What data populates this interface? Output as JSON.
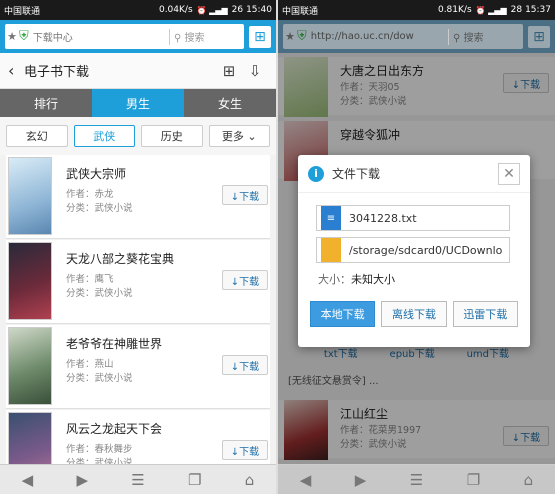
{
  "left": {
    "status": {
      "carrier": "中国联通",
      "speed": "0.04K/s",
      "battery": "26",
      "time": "15:40"
    },
    "urlbar": {
      "url": "下载中心",
      "search_placeholder": "搜索"
    },
    "header": {
      "title": "电子书下载"
    },
    "tabs": [
      {
        "label": "排行"
      },
      {
        "label": "男生"
      },
      {
        "label": "女生"
      }
    ],
    "categories": [
      {
        "label": "玄幻"
      },
      {
        "label": "武侠"
      },
      {
        "label": "历史"
      },
      {
        "label": "更多 ⌄"
      }
    ],
    "books": [
      {
        "title": "武侠大宗师",
        "author": "作者：赤龙",
        "category": "分类：武侠小说",
        "button": "↓下载"
      },
      {
        "title": "天龙八部之葵花宝典",
        "author": "作者：鹰飞",
        "category": "分类：武侠小说",
        "button": "↓下载"
      },
      {
        "title": "老爷爷在神雕世界",
        "author": "作者：燕山",
        "category": "分类：武侠小说",
        "button": "↓下载"
      },
      {
        "title": "风云之龙起天下会",
        "author": "作者：春秋舞步",
        "category": "分类：武侠小说",
        "button": "↓下载"
      }
    ],
    "colors": {
      "accent": "#1e9fd9"
    }
  },
  "right": {
    "status": {
      "carrier": "中国联通",
      "speed": "0.81K/s",
      "battery": "28",
      "time": "15:37"
    },
    "urlbar": {
      "url": "http://hao.uc.cn/dow",
      "search_placeholder": "搜索"
    },
    "books": [
      {
        "title": "大唐之日出东方",
        "author": "作者：天羽05",
        "category": "分类：武侠小说",
        "button": "↓下载"
      },
      {
        "title": "穿越令狐冲",
        "author": "",
        "category": "",
        "button": ""
      },
      {
        "title": "江山红尘",
        "author": "作者：花菜男1997",
        "category": "分类：武侠小说",
        "button": "↓下载"
      }
    ],
    "partial_buttons": [
      "txt下载",
      "epub下载",
      "umd下载"
    ],
    "promo": "[无线征文悬赏令] ...",
    "dialog": {
      "title": "文件下载",
      "filename": "3041228.txt",
      "path": "/storage/sdcard0/UCDownlo",
      "size_label": "大小：",
      "size_value": "未知大小",
      "buttons": {
        "local": "本地下载",
        "offline": "离线下载",
        "xunlei": "迅雷下载"
      }
    }
  }
}
